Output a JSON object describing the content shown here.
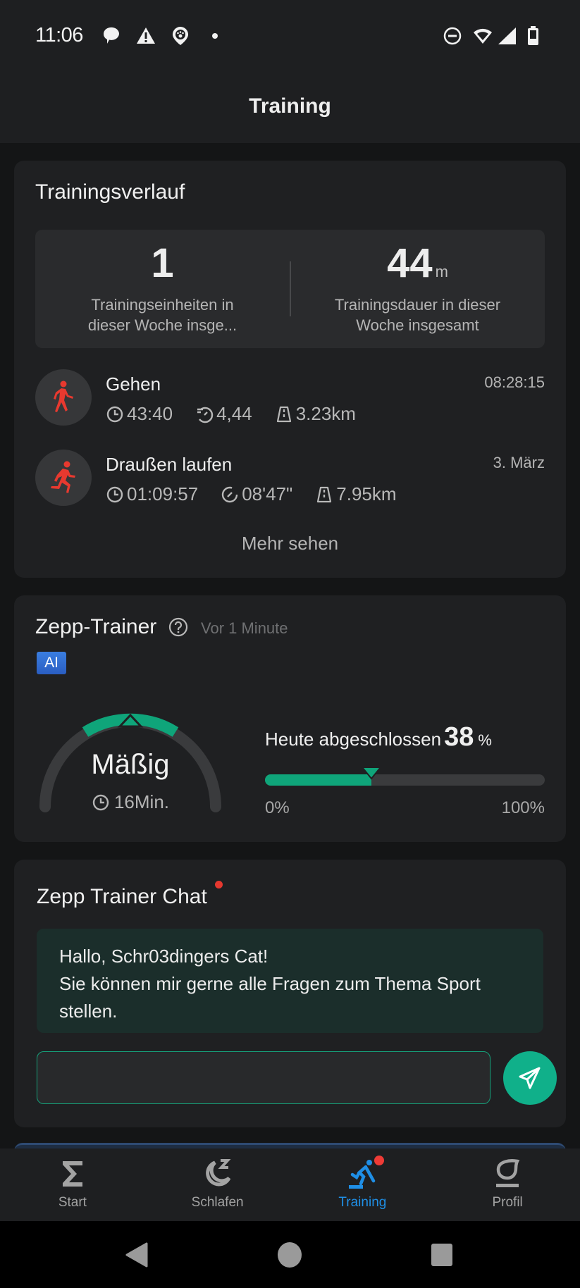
{
  "status_bar": {
    "time": "11:06",
    "left_icons": [
      "chat-bubble-icon",
      "warning-icon",
      "pet-location-icon",
      "dot-icon"
    ],
    "right_icons": [
      "do-not-disturb-icon",
      "wifi-icon",
      "signal-icon",
      "battery-icon"
    ]
  },
  "app_bar": {
    "title": "Training"
  },
  "history": {
    "title": "Trainingsverlauf",
    "stats": [
      {
        "value": "1",
        "unit": "",
        "label": "Trainingseinheiten in dieser Woche insge..."
      },
      {
        "value": "44",
        "unit": "m",
        "label": "Trainingsdauer in dieser Woche insgesamt"
      }
    ],
    "workouts": [
      {
        "name": "Gehen",
        "icon": "walking-icon",
        "date": "08:28:15",
        "duration": "43:40",
        "pace_icon": "cadence-icon",
        "pace": "4,44",
        "distance": "3.23km"
      },
      {
        "name": "Draußen laufen",
        "icon": "running-icon",
        "date": "3. März",
        "duration": "01:09:57",
        "pace_icon": "pace-icon",
        "pace": "08'47\"",
        "distance": "7.95km"
      }
    ],
    "more_label": "Mehr sehen"
  },
  "trainer": {
    "title": "Zepp-Trainer",
    "timeago": "Vor 1 Minute",
    "ai_badge": "AI",
    "intensity": "Mäßig",
    "duration": "16Min.",
    "progress_label": "Heute abgeschlossen",
    "progress_value": "38",
    "progress_fraction": 0.38,
    "progress_unit": "%",
    "progress_min": "0%",
    "progress_max": "100%",
    "accent_color": "#0fa57a"
  },
  "chat": {
    "title": "Zepp Trainer Chat",
    "has_unread": true,
    "message_line1": "Hallo, Schr03dingers Cat!",
    "message_line2": "Sie können mir gerne alle Fragen zum Thema Sport stellen.",
    "input_value": "",
    "input_placeholder": ""
  },
  "bottom_nav": {
    "items": [
      {
        "label": "Start",
        "icon": "sigma-icon",
        "active": false
      },
      {
        "label": "Schlafen",
        "icon": "sleep-moon-icon",
        "active": false
      },
      {
        "label": "Training",
        "icon": "workout-icon",
        "active": true,
        "badge": true
      },
      {
        "label": "Profil",
        "icon": "profile-icon",
        "active": false
      }
    ],
    "active_color": "#1f8fe6"
  },
  "system_nav": {
    "buttons": [
      "back",
      "home",
      "recents"
    ]
  }
}
